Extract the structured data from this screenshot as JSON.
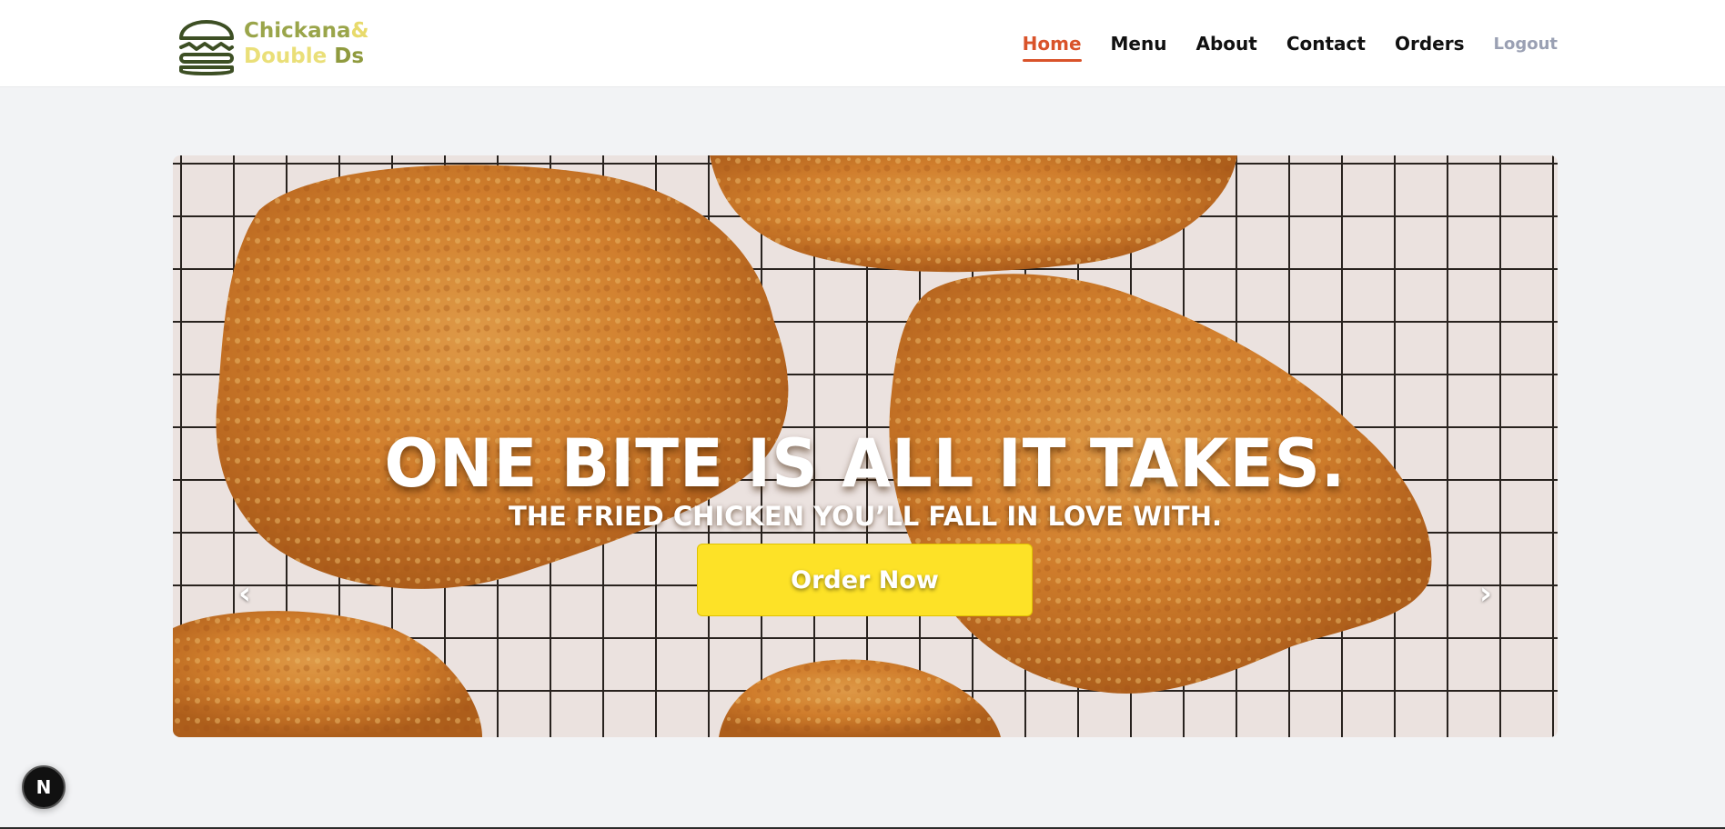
{
  "brand": {
    "line1": "Chickana",
    "line1_amp": "&",
    "line2": "Double",
    "line2_ds": " Ds",
    "logo_icon": "burger-icon",
    "colors": {
      "olive": "#9aa54a",
      "light_yellow": "#eadf78",
      "icon": "#3d4f24"
    }
  },
  "nav": {
    "home": "Home",
    "menu": "Menu",
    "about": "About",
    "contact": "Contact",
    "orders": "Orders",
    "logout": "Logout",
    "active": "Home",
    "active_color": "#d9532a"
  },
  "hero": {
    "headline": "ONE BITE IS ALL IT TAKES.",
    "subline": "THE FRIED CHICKEN YOU’LL FALL IN LOVE WITH.",
    "cta_label": "Order Now",
    "cta_color": "#fde227",
    "prev_icon": "chevron-left-icon",
    "next_icon": "chevron-right-icon",
    "prev_glyph": "‹",
    "next_glyph": "›"
  },
  "badge": {
    "label": "N",
    "icon": "nextjs-icon"
  }
}
